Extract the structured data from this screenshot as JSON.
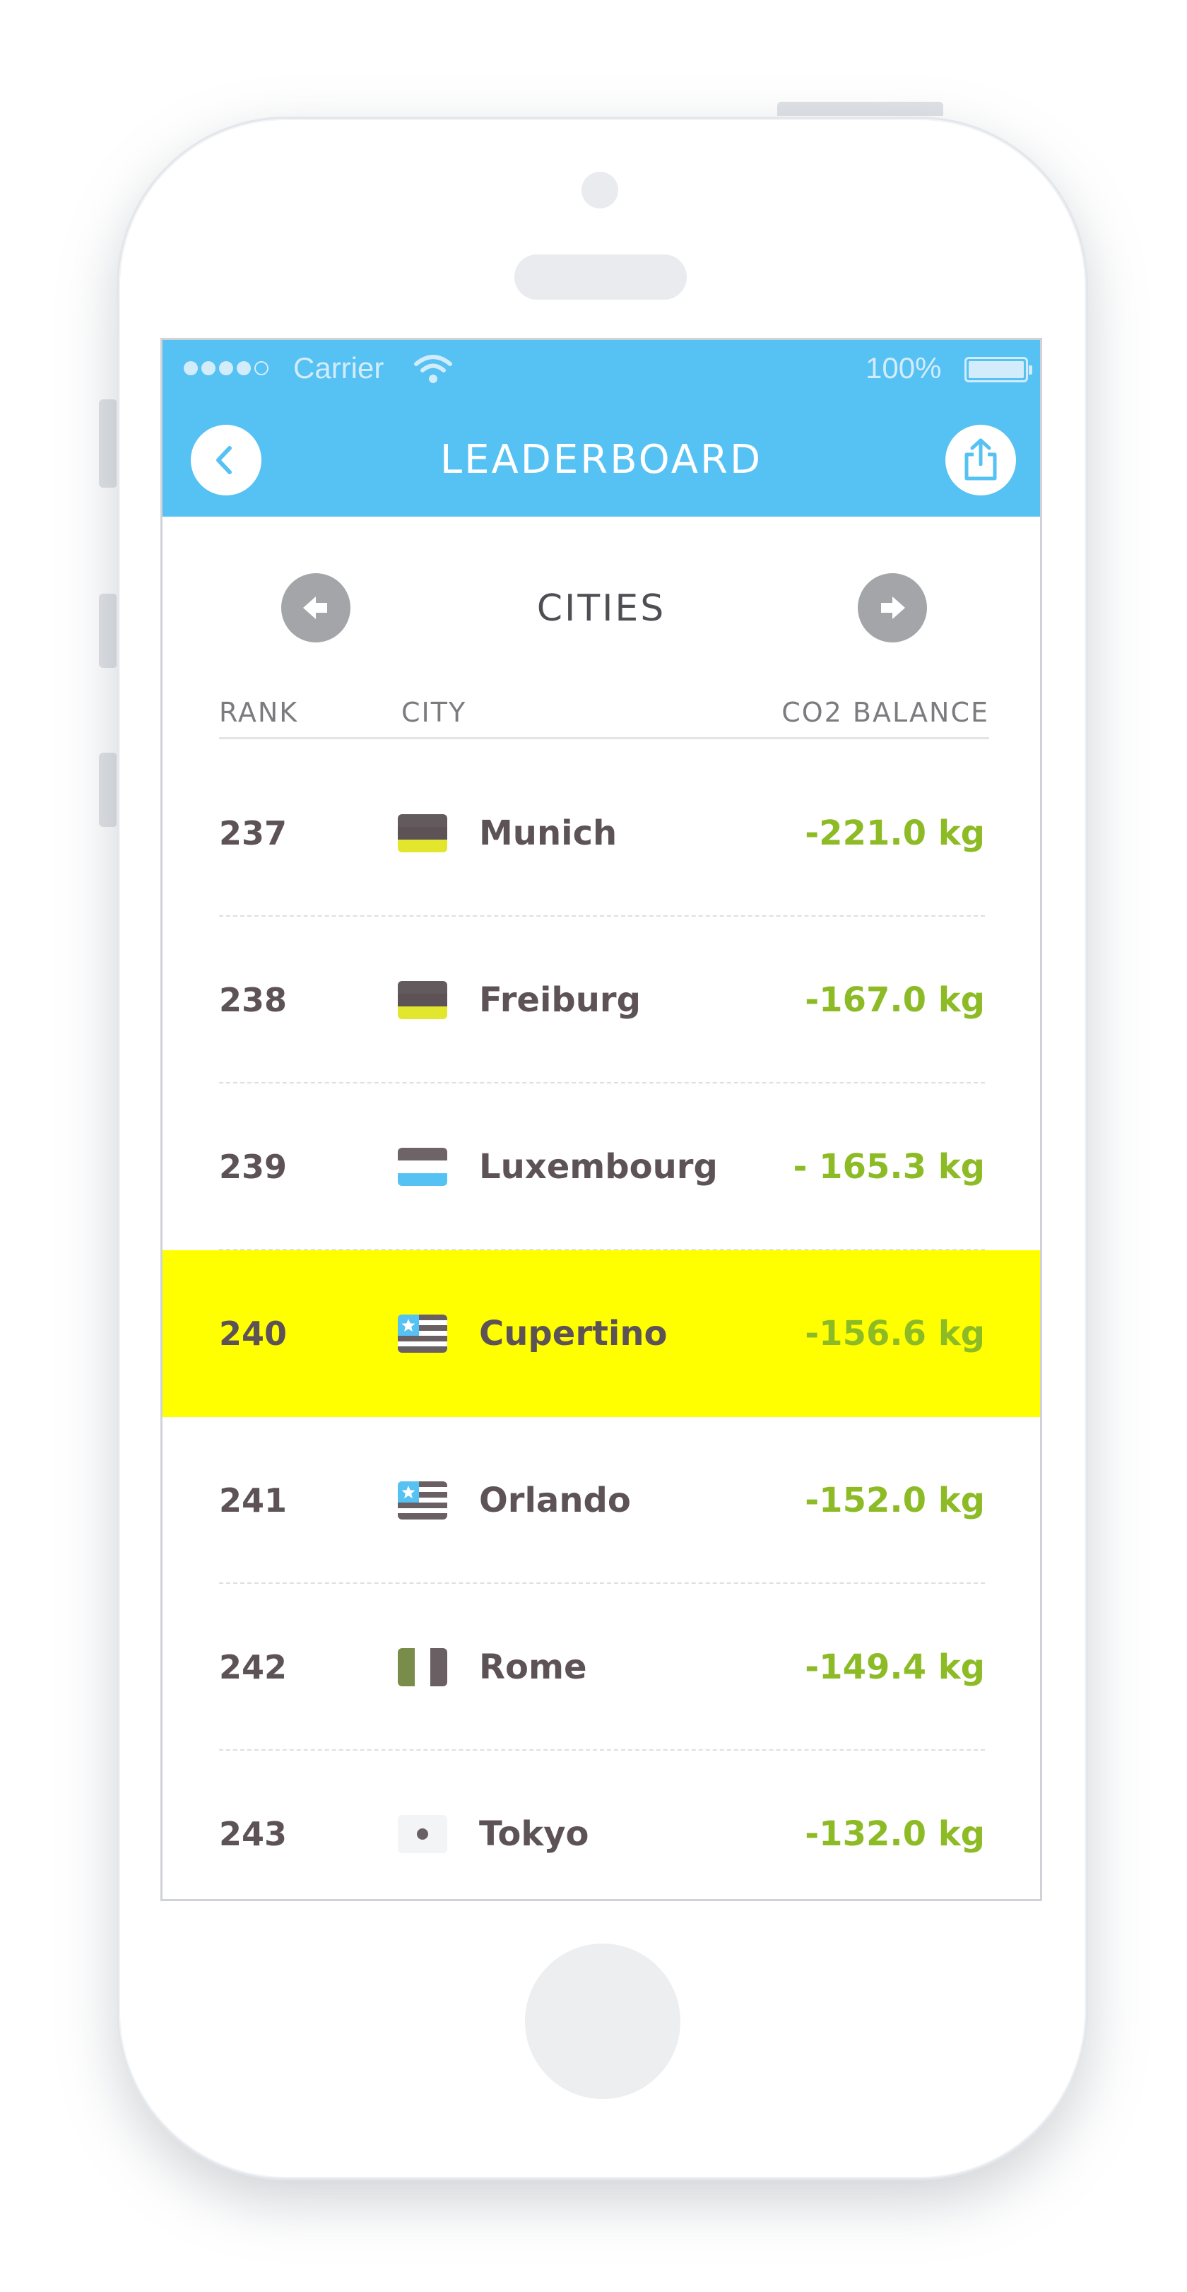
{
  "status_bar": {
    "carrier": "Carrier",
    "battery": "100%",
    "signal_bars": [
      true,
      true,
      true,
      true,
      false
    ]
  },
  "nav": {
    "title": "LEADERBOARD",
    "back_icon": "chevron-left-icon",
    "share_icon": "share-icon"
  },
  "category": {
    "title": "CITIES",
    "prev_icon": "arrow-left-icon",
    "next_icon": "arrow-right-icon"
  },
  "table": {
    "headers": {
      "rank": "RANK",
      "city": "CITY",
      "co2": "CO2 BALANCE"
    },
    "rows": [
      {
        "rank": "237",
        "city": "Munich",
        "co2": "-221.0 kg",
        "flag": "de",
        "highlight": false
      },
      {
        "rank": "238",
        "city": "Freiburg",
        "co2": "-167.0 kg",
        "flag": "de",
        "highlight": false
      },
      {
        "rank": "239",
        "city": "Luxembourg",
        "co2": "- 165.3 kg",
        "flag": "lu",
        "highlight": false
      },
      {
        "rank": "240",
        "city": "Cupertino",
        "co2": "-156.6 kg",
        "flag": "us",
        "highlight": true
      },
      {
        "rank": "241",
        "city": "Orlando",
        "co2": "-152.0 kg",
        "flag": "us",
        "highlight": false
      },
      {
        "rank": "242",
        "city": "Rome",
        "co2": "-149.4 kg",
        "flag": "it",
        "highlight": false
      },
      {
        "rank": "243",
        "city": "Tokyo",
        "co2": "-132.0 kg",
        "flag": "jp",
        "highlight": false
      }
    ]
  },
  "colors": {
    "accent": "#56c1f3",
    "highlight": "#ffff00",
    "co2_value": "#8dbb26",
    "text": "#5d5356"
  }
}
